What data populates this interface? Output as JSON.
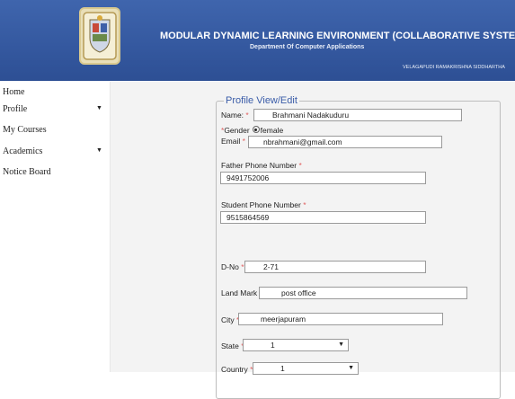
{
  "header": {
    "title": "MODULAR DYNAMIC LEARNING ENVIRONMENT (COLLABORATIVE SYSTEM)",
    "subtitle": "Department Of Computer Applications",
    "college": "VELAGAPUDI RAMAKRISHNA SIDDHARTHA",
    "logo_icon": "college-crest-icon"
  },
  "sidebar": {
    "items": [
      {
        "label": "Home",
        "has_caret": false
      },
      {
        "label": "Profile",
        "has_caret": true
      },
      {
        "label": "My Courses",
        "has_caret": false
      },
      {
        "label": "Academics",
        "has_caret": true
      },
      {
        "label": "Notice Board",
        "has_caret": false
      }
    ],
    "caret": "▼"
  },
  "form": {
    "legend": "Profile View/Edit",
    "required_mark": "*",
    "name": {
      "label": "Name:",
      "value": "Brahmani Nadakuduru"
    },
    "gender": {
      "label": "Gender",
      "value": "female"
    },
    "email": {
      "label": "Email",
      "value": "nbrahmani@gmail.com"
    },
    "father_phone": {
      "label": "Father Phone Number",
      "value": "9491752006"
    },
    "student_phone": {
      "label": "Student Phone Number",
      "value": "9515864569"
    },
    "dno": {
      "label": "D-No",
      "value": "2-71"
    },
    "landmark": {
      "label": "Land Mark",
      "value": "post office"
    },
    "city": {
      "label": "City",
      "value": "meerjapuram"
    },
    "state": {
      "label": "State",
      "value": "1"
    },
    "country": {
      "label": "Country",
      "value": "1"
    }
  },
  "colors": {
    "header_bg": "#3559a0",
    "legend_text": "#3a5ca8",
    "required_star": "#e06060",
    "content_bg": "#f3f3f3"
  }
}
